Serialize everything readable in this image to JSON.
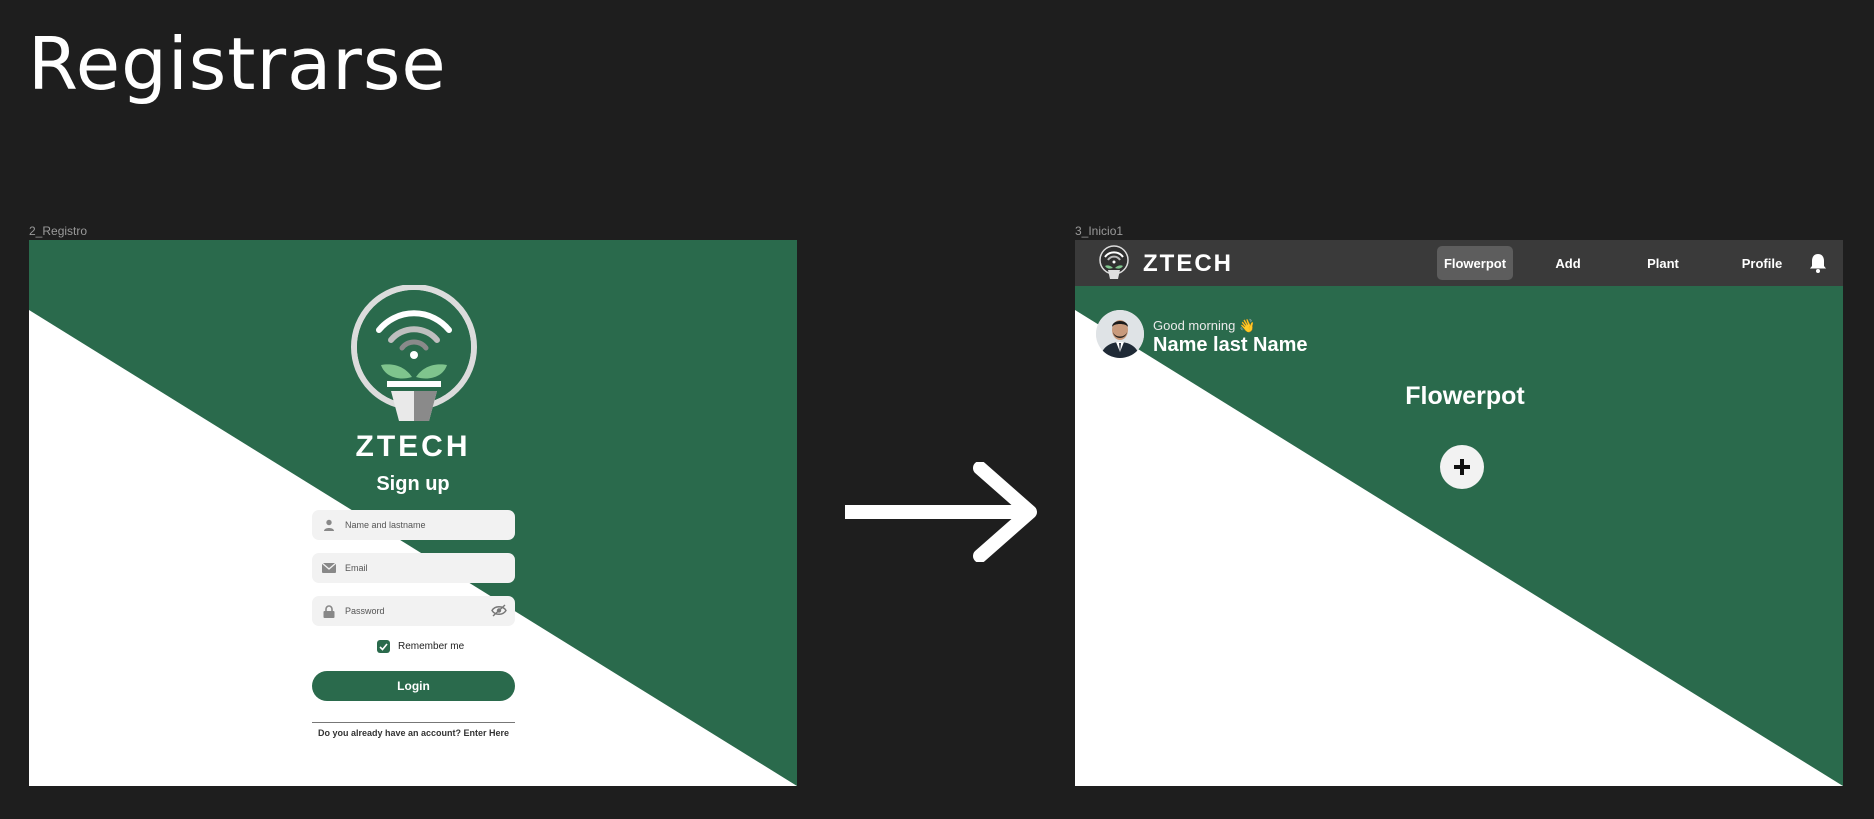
{
  "page": {
    "title": "Registrarse"
  },
  "frames": {
    "registro_label": "2_Registro",
    "inicio_label": "3_Inicio1"
  },
  "signup": {
    "brand": "ZTECH",
    "title": "Sign up",
    "name_placeholder": "Name and lastname",
    "email_placeholder": "Email",
    "password_placeholder": "Password",
    "remember_label": "Remember me",
    "remember_checked": true,
    "login_label": "Login",
    "account_text": "Do you already have an account? Enter Here",
    "icons": [
      "person-icon",
      "mail-icon",
      "lock-icon",
      "eye-off-icon",
      "check-icon"
    ]
  },
  "home": {
    "brand": "ZTECH",
    "nav": [
      {
        "label": "Flowerpot",
        "active": true
      },
      {
        "label": "Add",
        "active": false
      },
      {
        "label": "Plant",
        "active": false
      },
      {
        "label": "Profile",
        "active": false
      }
    ],
    "greeting": "Good morning 👋",
    "user_name": "Name last Name",
    "section_title": "Flowerpot",
    "icons": [
      "bell-icon",
      "plus-icon",
      "avatar"
    ]
  },
  "colors": {
    "background": "#1e1e1e",
    "brand_green": "#2a6a4c",
    "white": "#ffffff",
    "navbar": "#3a3a3a",
    "field": "#f2f2f2"
  }
}
